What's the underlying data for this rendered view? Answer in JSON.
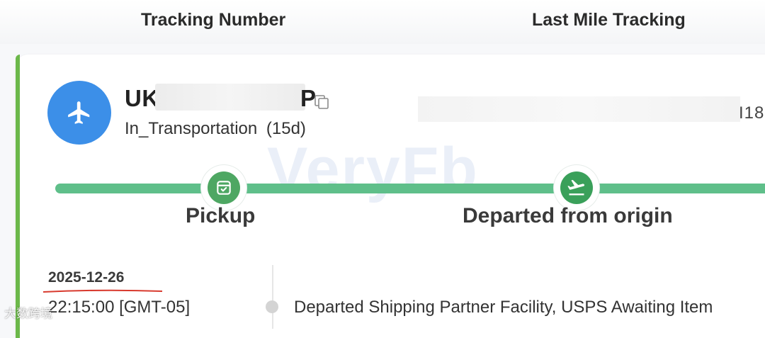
{
  "columns": {
    "tracking_number": "Tracking Number",
    "last_mile_tracking": "Last Mile Tracking"
  },
  "shipment": {
    "icon": "airplane-icon",
    "tracking_prefix": "UK",
    "tracking_suffix": "P",
    "status": "In_Transportation",
    "days": "(15d)",
    "last_mile_fragment": "I18",
    "accent_color": "#6cb84a",
    "avatar_color": "#3c8fe8"
  },
  "watermark": "VeryFb",
  "milestones": [
    {
      "label": "Pickup",
      "icon": "package-check-icon"
    },
    {
      "label": "Departed from origin",
      "icon": "plane-departure-icon"
    }
  ],
  "progress_color": "#5fbf8a",
  "event": {
    "date": "2025-12-26",
    "time": "22:15:00 [GMT-05]",
    "description": "Departed Shipping Partner Facility, USPS Awaiting Item"
  },
  "credit": "大数跨境"
}
